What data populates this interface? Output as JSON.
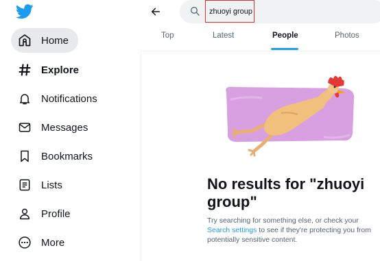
{
  "sidebar": {
    "items": [
      {
        "label": "Home",
        "icon": "home-icon"
      },
      {
        "label": "Explore",
        "icon": "hashtag-icon"
      },
      {
        "label": "Notifications",
        "icon": "bell-icon"
      },
      {
        "label": "Messages",
        "icon": "envelope-icon"
      },
      {
        "label": "Bookmarks",
        "icon": "bookmark-icon"
      },
      {
        "label": "Lists",
        "icon": "list-icon"
      },
      {
        "label": "Profile",
        "icon": "person-icon"
      },
      {
        "label": "More",
        "icon": "more-circle-icon"
      }
    ]
  },
  "search": {
    "value": "zhuoyi group"
  },
  "tabs": [
    {
      "label": "Top"
    },
    {
      "label": "Latest"
    },
    {
      "label": "People",
      "active": true
    },
    {
      "label": "Photos"
    }
  ],
  "empty_state": {
    "title": "No results for \"zhuoyi group\"",
    "text_before": "Try searching for something else, or check your ",
    "link": "Search settings",
    "text_after": " to see if they're protecting you from potentially sensitive content."
  },
  "colors": {
    "brand": "#1d9bf0",
    "highlight_border": "#d9302f",
    "illustration_bg": "#d8a0e0"
  }
}
